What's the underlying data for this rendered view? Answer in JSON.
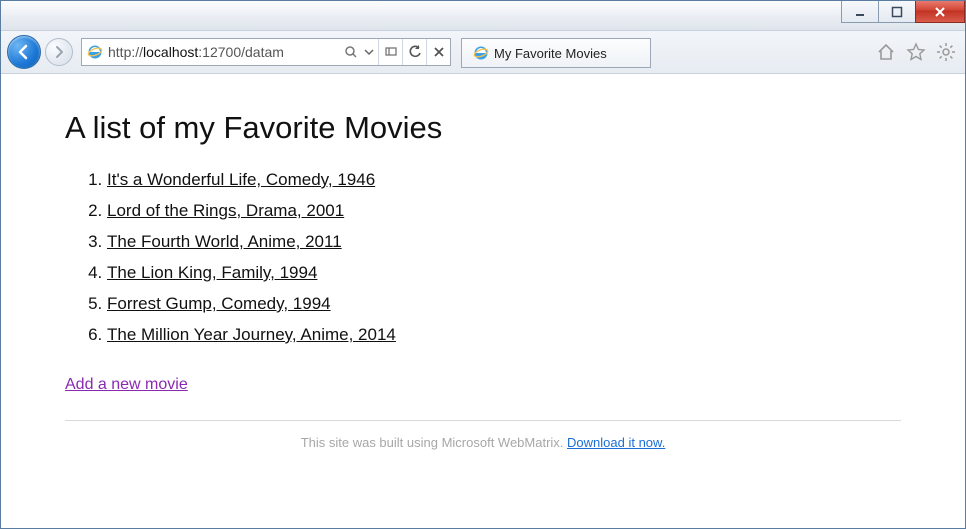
{
  "window": {
    "url_prefix": "http://",
    "url_host": "localhost",
    "url_rest": ":12700/datam",
    "tab_title": "My Favorite Movies"
  },
  "page": {
    "heading": "A list of my Favorite Movies",
    "movies": [
      "It's a Wonderful Life, Comedy, 1946",
      "Lord of the Rings, Drama, 2001",
      "The Fourth World, Anime, 2011",
      "The Lion King, Family, 1994",
      "Forrest Gump, Comedy, 1994",
      "The Million Year Journey, Anime, 2014"
    ],
    "add_link": "Add a new movie",
    "footer_text": "This site was built using Microsoft WebMatrix. ",
    "footer_link": "Download it now."
  }
}
